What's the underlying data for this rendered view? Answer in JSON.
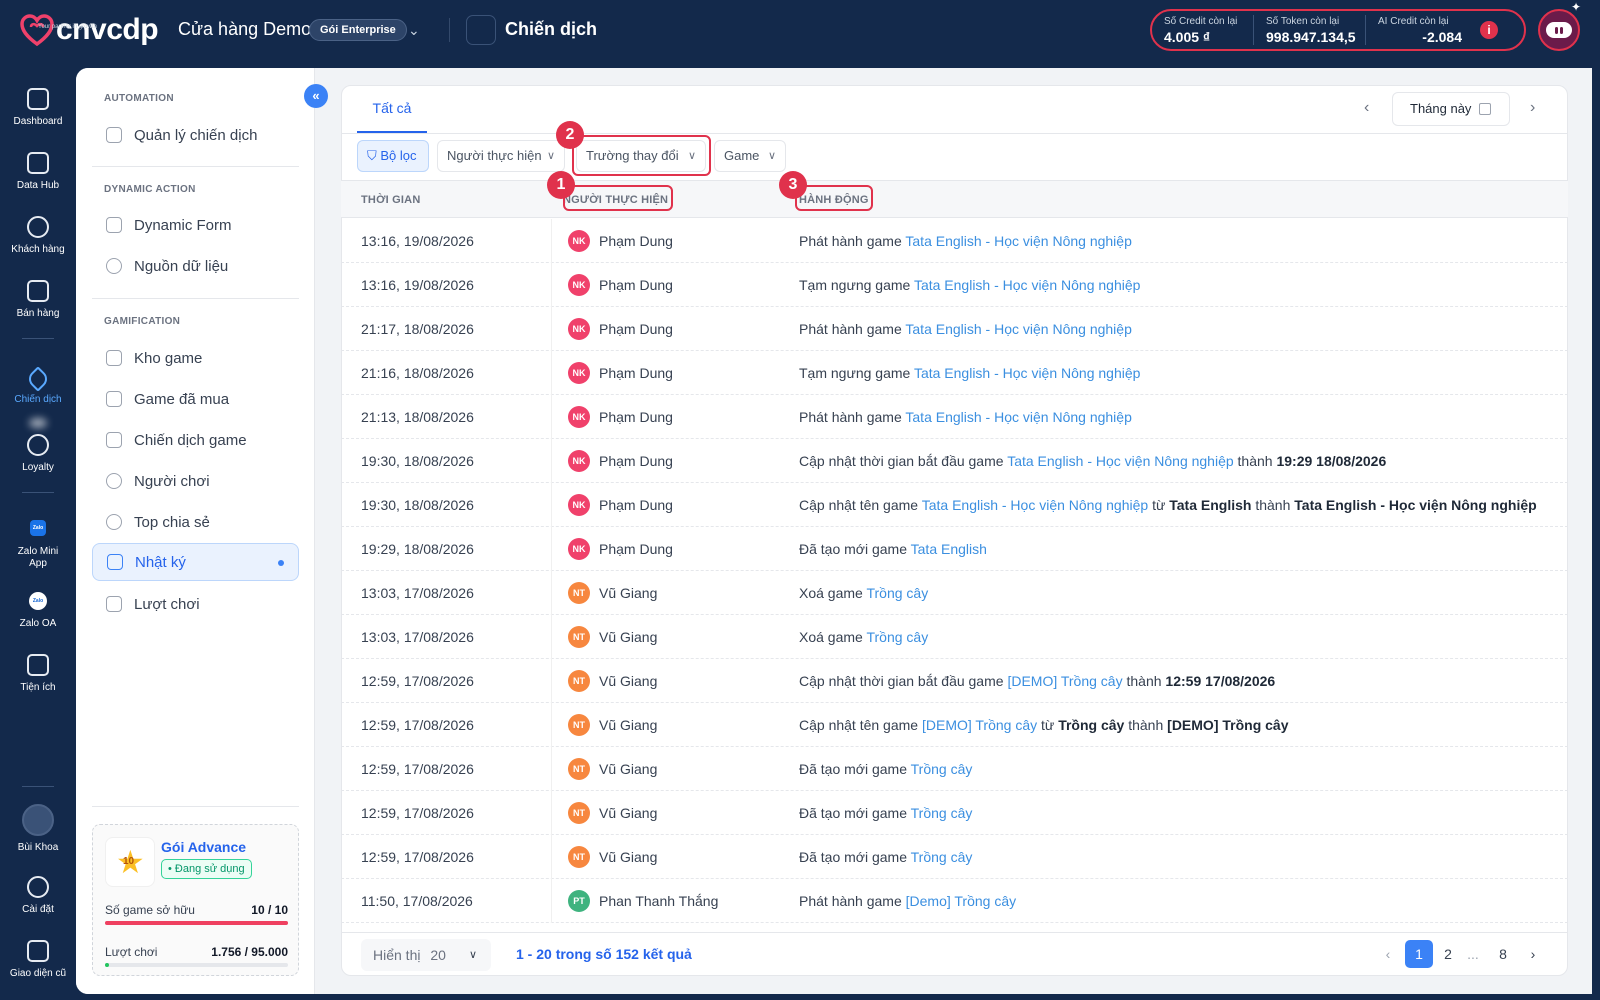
{
  "header": {
    "logo_text": "cnvcdp",
    "logo_tagline": "Your partner in growth",
    "store_name": "Cửa hàng Demo",
    "plan_badge": "Gói Enterprise",
    "page_title": "Chiến dịch",
    "credits": [
      {
        "label": "Số Credit còn lại",
        "value": "4.005 ₫"
      },
      {
        "label": "Số Token còn lại",
        "value": "998.947.134,5"
      },
      {
        "label": "AI Credit còn lại",
        "value": "-2.084"
      }
    ],
    "info_symbol": "i"
  },
  "rail": [
    {
      "label": "Dashboard",
      "icon": "grid-icon"
    },
    {
      "label": "Data Hub",
      "icon": "data-hub-icon"
    },
    {
      "label": "Khách hàng",
      "icon": "customers-icon"
    },
    {
      "label": "Bán hàng",
      "icon": "shop-icon"
    },
    {
      "label": "Chiến dịch",
      "icon": "rocket-icon",
      "active": true
    },
    {
      "label": "Loyalty",
      "icon": "award-icon"
    },
    {
      "label": "Zalo Mini App",
      "icon": "zalo-mini-app-icon"
    },
    {
      "label": "Zalo OA",
      "icon": "zalo-oa-icon"
    },
    {
      "label": "Tiện ích",
      "icon": "add-apps-icon"
    },
    {
      "label": "Bùi Khoa",
      "icon": "user-avatar-icon"
    },
    {
      "label": "Cài đặt",
      "icon": "gear-icon"
    },
    {
      "label": "Giao diện cũ",
      "icon": "switch-icon"
    }
  ],
  "sidebar": {
    "sections": [
      {
        "title": "AUTOMATION",
        "items": [
          {
            "label": "Quản lý chiến dịch",
            "icon": "rocket-icon"
          }
        ]
      },
      {
        "title": "DYNAMIC ACTION",
        "items": [
          {
            "label": "Dynamic Form",
            "icon": "form-icon"
          },
          {
            "label": "Nguồn dữ liệu",
            "icon": "cloud-icon"
          }
        ]
      },
      {
        "title": "GAMIFICATION",
        "items": [
          {
            "label": "Kho game",
            "icon": "grid-icon"
          },
          {
            "label": "Game đã mua",
            "icon": "bag-icon"
          },
          {
            "label": "Chiến dịch game",
            "icon": "grid-icon"
          },
          {
            "label": "Người chơi",
            "icon": "players-icon"
          },
          {
            "label": "Top chia sẻ",
            "icon": "share-icon"
          },
          {
            "label": "Nhật ký",
            "icon": "log-icon",
            "active": true
          },
          {
            "label": "Lượt chơi",
            "icon": "click-icon"
          }
        ]
      }
    ],
    "plan_card": {
      "star_number": "10",
      "title": "Gói Advance",
      "status": "• Đang sử dụng",
      "games_label": "Số game sở hữu",
      "games_value": "10 / 10",
      "games_fraction": 1.0,
      "plays_label": "Lượt chơi",
      "plays_value": "1.756 / 95.000",
      "plays_fraction": 0.018
    }
  },
  "content": {
    "tab_all": "Tất cả",
    "month_label": "Tháng này",
    "filters": {
      "filter_button": "Bộ lọc",
      "performer": "Người thực hiện",
      "changed_field": "Trường thay đổi",
      "game": "Game"
    },
    "annotations": [
      "1",
      "2",
      "3"
    ],
    "columns": {
      "time": "THỜI GIAN",
      "performer": "NGƯỜI THỰC HIỆN",
      "action": "HÀNH ĐỘNG"
    },
    "rows": [
      {
        "time": "13:16, 19/08/2026",
        "initials": "NK",
        "color": "#f0416b",
        "user": "Phạm Dung",
        "action": [
          {
            "t": "Phát hành game "
          },
          {
            "t": "Tata English - Học viện Nông nghiệp",
            "k": "link"
          }
        ]
      },
      {
        "time": "13:16, 19/08/2026",
        "initials": "NK",
        "color": "#f0416b",
        "user": "Phạm Dung",
        "action": [
          {
            "t": "Tạm ngưng game "
          },
          {
            "t": "Tata English - Học viện Nông nghiệp",
            "k": "link"
          }
        ]
      },
      {
        "time": "21:17, 18/08/2026",
        "initials": "NK",
        "color": "#f0416b",
        "user": "Phạm Dung",
        "action": [
          {
            "t": "Phát hành game "
          },
          {
            "t": "Tata English - Học viện Nông nghiệp",
            "k": "link"
          }
        ]
      },
      {
        "time": "21:16, 18/08/2026",
        "initials": "NK",
        "color": "#f0416b",
        "user": "Phạm Dung",
        "action": [
          {
            "t": "Tạm ngưng game "
          },
          {
            "t": "Tata English - Học viện Nông nghiệp",
            "k": "link"
          }
        ]
      },
      {
        "time": "21:13, 18/08/2026",
        "initials": "NK",
        "color": "#f0416b",
        "user": "Phạm Dung",
        "action": [
          {
            "t": "Phát hành game "
          },
          {
            "t": "Tata English - Học viện Nông nghiệp",
            "k": "link"
          }
        ]
      },
      {
        "time": "19:30, 18/08/2026",
        "initials": "NK",
        "color": "#f0416b",
        "user": "Phạm Dung",
        "action": [
          {
            "t": "Cập nhật thời gian bắt đầu game "
          },
          {
            "t": "Tata English - Học viện Nông nghiệp",
            "k": "link"
          },
          {
            "t": " thành "
          },
          {
            "t": "19:29 18/08/2026",
            "k": "bold"
          }
        ]
      },
      {
        "time": "19:30, 18/08/2026",
        "initials": "NK",
        "color": "#f0416b",
        "user": "Phạm Dung",
        "action": [
          {
            "t": "Cập nhật tên game "
          },
          {
            "t": "Tata English - Học viện Nông nghiệp",
            "k": "link"
          },
          {
            "t": " từ "
          },
          {
            "t": "Tata English",
            "k": "bold"
          },
          {
            "t": " thành "
          },
          {
            "t": "Tata English - Học viện Nông nghiệp",
            "k": "bold"
          }
        ]
      },
      {
        "time": "19:29, 18/08/2026",
        "initials": "NK",
        "color": "#f0416b",
        "user": "Phạm Dung",
        "action": [
          {
            "t": "Đã tạo mới game "
          },
          {
            "t": "Tata English",
            "k": "link"
          }
        ]
      },
      {
        "time": "13:03, 17/08/2026",
        "initials": "NT",
        "color": "#f7873f",
        "user": "Vũ Giang",
        "action": [
          {
            "t": "Xoá game "
          },
          {
            "t": "Trồng cây",
            "k": "link"
          }
        ]
      },
      {
        "time": "13:03, 17/08/2026",
        "initials": "NT",
        "color": "#f7873f",
        "user": "Vũ Giang",
        "action": [
          {
            "t": "Xoá game "
          },
          {
            "t": "Trồng cây",
            "k": "link"
          }
        ]
      },
      {
        "time": "12:59, 17/08/2026",
        "initials": "NT",
        "color": "#f7873f",
        "user": "Vũ Giang",
        "action": [
          {
            "t": "Cập nhật thời gian bắt đầu game "
          },
          {
            "t": "[DEMO] Trồng cây",
            "k": "link"
          },
          {
            "t": " thành "
          },
          {
            "t": "12:59 17/08/2026",
            "k": "bold"
          }
        ]
      },
      {
        "time": "12:59, 17/08/2026",
        "initials": "NT",
        "color": "#f7873f",
        "user": "Vũ Giang",
        "action": [
          {
            "t": "Cập nhật tên game "
          },
          {
            "t": "[DEMO] Trồng cây",
            "k": "link"
          },
          {
            "t": " từ "
          },
          {
            "t": "Trồng cây",
            "k": "bold"
          },
          {
            "t": " thành "
          },
          {
            "t": "[DEMO] Trồng cây",
            "k": "bold"
          }
        ]
      },
      {
        "time": "12:59, 17/08/2026",
        "initials": "NT",
        "color": "#f7873f",
        "user": "Vũ Giang",
        "action": [
          {
            "t": "Đã tạo mới game "
          },
          {
            "t": "Trồng cây",
            "k": "link"
          }
        ]
      },
      {
        "time": "12:59, 17/08/2026",
        "initials": "NT",
        "color": "#f7873f",
        "user": "Vũ Giang",
        "action": [
          {
            "t": "Đã tạo mới game "
          },
          {
            "t": "Trồng cây",
            "k": "link"
          }
        ]
      },
      {
        "time": "12:59, 17/08/2026",
        "initials": "NT",
        "color": "#f7873f",
        "user": "Vũ Giang",
        "action": [
          {
            "t": "Đã tạo mới game "
          },
          {
            "t": "Trồng cây",
            "k": "link"
          }
        ]
      },
      {
        "time": "11:50, 17/08/2026",
        "initials": "PT",
        "color": "#3fb37f",
        "user": "Phan Thanh Thắng",
        "action": [
          {
            "t": "Phát hành game "
          },
          {
            "t": "[Demo] Trồng cây",
            "k": "link"
          }
        ]
      }
    ],
    "footer": {
      "page_size_label": "Hiển thị",
      "page_size_value": "20",
      "result_text": "1 - 20 trong số 152 kết quả",
      "pages": [
        "1",
        "2",
        "...",
        "8"
      ],
      "current_page": "1"
    }
  }
}
